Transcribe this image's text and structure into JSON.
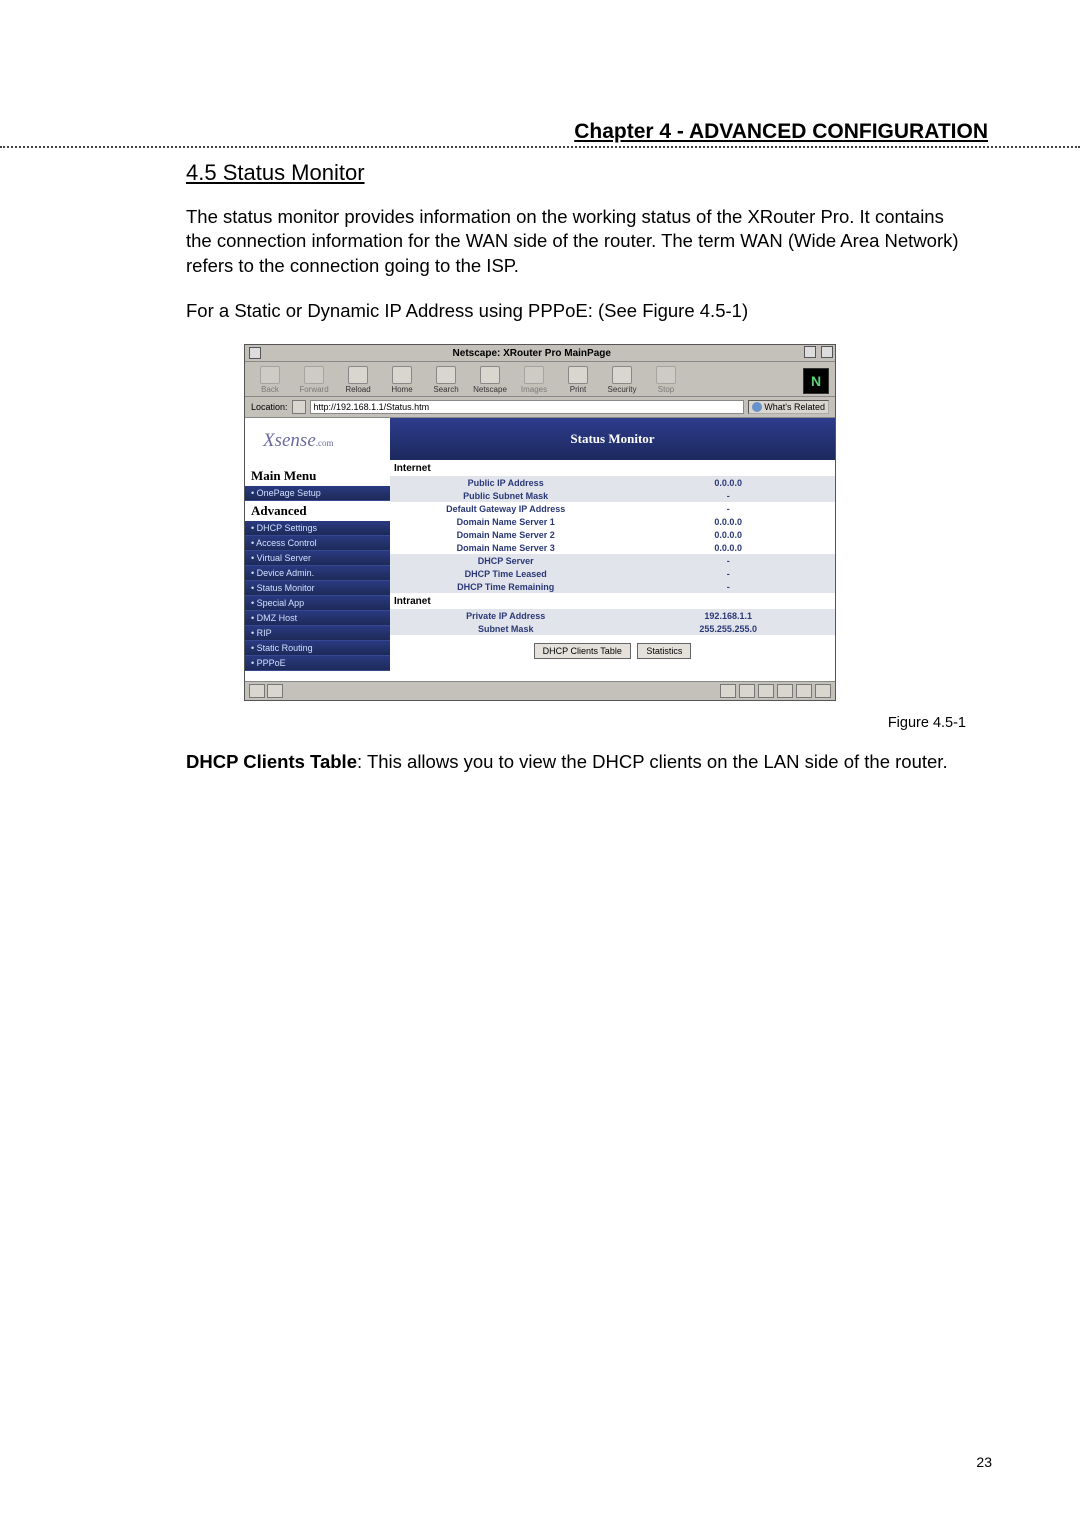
{
  "chapter": "Chapter 4 - ADVANCED CONFIGURATION",
  "section_title": "4.5  Status Monitor",
  "para1": "The status monitor provides information on the working status of the XRouter Pro.  It contains the connection information for the WAN side of the router.   The term WAN (Wide Area Network) refers to the connection going to the ISP.",
  "para2": "For a Static or Dynamic IP Address using PPPoE:   (See Figure 4.5-1)",
  "figure_label": "Figure 4.5-1",
  "caption_bold": "DHCP Clients Table",
  "caption_rest": ":  This allows you to view the DHCP clients on the LAN side of the router.",
  "page_number": "23",
  "netscape": {
    "window_title": "Netscape: XRouter Pro MainPage",
    "toolbar": {
      "back": "Back",
      "forward": "Forward",
      "reload": "Reload",
      "home": "Home",
      "search": "Search",
      "netscape": "Netscape",
      "images": "Images",
      "print": "Print",
      "security": "Security",
      "stop": "Stop"
    },
    "location_label": "Location:",
    "location_url": "http://192.168.1.1/Status.htm",
    "related": "What's Related",
    "brand": "Xsense",
    "brand_sub": ".com",
    "menu": {
      "main_header": "Main Menu",
      "item_onepage": "OnePage Setup",
      "adv_header": "Advanced",
      "items": [
        "DHCP Settings",
        "Access Control",
        "Virtual Server",
        "Device Admin.",
        "Status Monitor",
        "Special App",
        "DMZ Host",
        "RIP",
        "Static Routing",
        "PPPoE"
      ]
    },
    "status": {
      "header": "Status Monitor",
      "internet_label": "Internet",
      "intranet_label": "Intranet",
      "internet_rows": [
        {
          "k": "Public IP Address",
          "v": "0.0.0.0"
        },
        {
          "k": "Public Subnet Mask",
          "v": "-"
        },
        {
          "k": "Default Gateway IP Address",
          "v": "-"
        },
        {
          "k": "Domain Name Server 1",
          "v": "0.0.0.0"
        },
        {
          "k": "Domain Name Server 2",
          "v": "0.0.0.0"
        },
        {
          "k": "Domain Name Server 3",
          "v": "0.0.0.0"
        },
        {
          "k": "DHCP Server",
          "v": "-"
        },
        {
          "k": "DHCP Time Leased",
          "v": "-"
        },
        {
          "k": "DHCP Time Remaining",
          "v": "-"
        }
      ],
      "intranet_rows": [
        {
          "k": "Private IP Address",
          "v": "192.168.1.1"
        },
        {
          "k": "Subnet Mask",
          "v": "255.255.255.0"
        }
      ],
      "btn_clients": "DHCP Clients Table",
      "btn_stats": "Statistics"
    }
  }
}
